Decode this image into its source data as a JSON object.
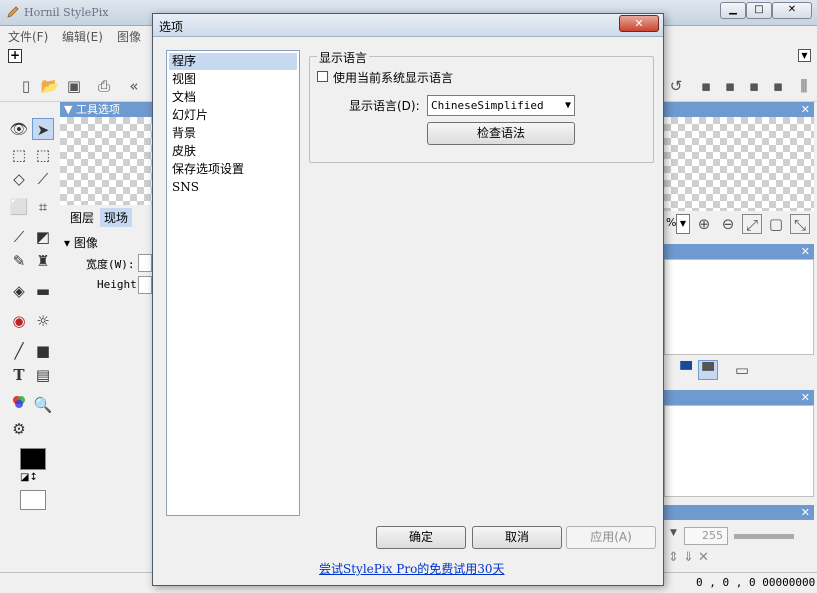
{
  "app": {
    "title": "Hornil StylePix",
    "menu": [
      "文件(F)",
      "编辑(E)",
      "图像"
    ],
    "tools_panel_title": "工具选项",
    "tabs": [
      "图层",
      "现场"
    ],
    "image_section": "图像",
    "width_label": "宽度(W):",
    "height_label": "Height",
    "zoom_suffix": "%",
    "spin_value": "255",
    "status_text": "0 , 0 , 0 00000000"
  },
  "dialog": {
    "title": "选项",
    "close_label": "✕",
    "categories": [
      {
        "label": "程序",
        "selected": true
      },
      {
        "label": "视图",
        "selected": false
      },
      {
        "label": "文档",
        "selected": false
      },
      {
        "label": "幻灯片",
        "selected": false
      },
      {
        "label": "背景",
        "selected": false
      },
      {
        "label": "皮肤",
        "selected": false
      },
      {
        "label": "保存选项设置",
        "selected": false
      },
      {
        "label": "SNS",
        "selected": false
      }
    ],
    "group_title": "显示语言",
    "use_system_language": "使用当前系统显示语言",
    "use_system_language_checked": false,
    "language_label": "显示语言(D):",
    "language_value": "ChineseSimplified",
    "check_grammar_button": "检查语法",
    "ok_button": "确定",
    "cancel_button": "取消",
    "apply_button": "应用(A)",
    "trial_link": "尝试StylePix Pro的免费试用30天"
  },
  "colors": {
    "accent": "#6f9ad0",
    "selection": "#c6d9f1",
    "link": "#0033cc"
  }
}
